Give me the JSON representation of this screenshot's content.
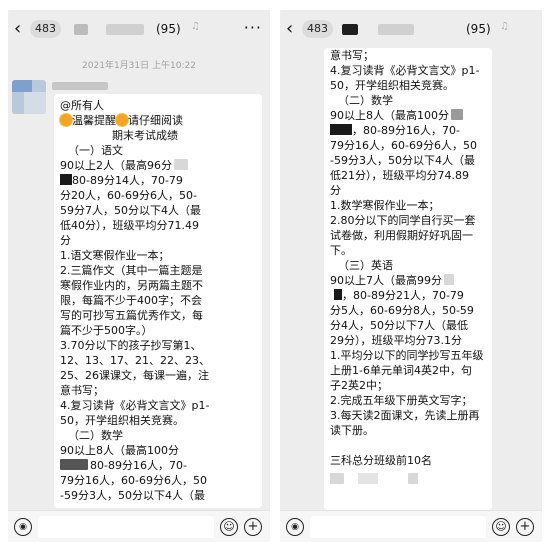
{
  "left": {
    "header": {
      "unread_count": "483",
      "member_count": "(95)"
    },
    "timestamp": "2021年1月31日 上午10:22",
    "message_lines": [
      "@所有人",
      "温馨提醒",
      "请仔细阅读",
      "期末考试成绩",
      "（一）语文",
      "90以上2人（最高96分",
      "80-89分14人，70-79",
      "分20人，60-69分6人，50-",
      "59分7人，50分以下4人（最",
      "低40分），班级平均分71.49",
      "分",
      "1.语文寒假作业一本；",
      "2.三篇作文（其中一篇主题是",
      "寒假作业内的，另两篇主题不",
      "限，每篇不少于400字；不会",
      "写的可抄写五篇优秀作文，每",
      "篇不少于500字。）",
      "3.70分以下的孩子抄写第1、",
      "12、13、17、21、22、23、",
      "25、26课课文，每课一遍，注",
      "意书写；",
      "4.复习读背《必背文言文》p1-",
      "50，开学组织相关竞赛。",
      "（二）数学",
      "90以上8人（最高100分",
      "80-89分16人，70-",
      "79分16人，60-69分6人，50",
      "-59分3人，50分以下4人（最"
    ]
  },
  "right": {
    "header": {
      "unread_count": "483",
      "member_count": "(95)"
    },
    "message_lines": [
      "意书写；",
      "4.复习读背《必背文言文》p1-",
      "50，开学组织相关竞赛。",
      "（二）数学",
      "90以上8人（最高100分",
      "，80-89分16人，70-",
      "79分16人，60-69分6人，50",
      "-59分3人，50分以下4人（最",
      "低21分），班级平均分74.89",
      "分",
      "1.数学寒假作业一本；",
      "2.80分以下的同学自行买一套",
      "试卷做，利用假期好好巩固一",
      "下。",
      "（三）英语",
      "90以上7人（最高99分",
      "，80-89分21人，70-79",
      "分5人，60-69分8人，50-59",
      "分4人，50分以下7人（最低",
      "29分），班级平均分73.1分",
      "1.平均分以下的同学抄写五年级",
      "上册1-6单元单词4英2中，句",
      "子2英2中；",
      "2.完成五年级下册英文写字；",
      "3.每天读2面课文，先读上册再",
      "读下册。",
      "三科总分班级前10名"
    ]
  },
  "icons": {
    "back": "‹",
    "more": "···",
    "voice": "◉",
    "emoji": "☺",
    "plus": "+",
    "mute": "♫"
  }
}
